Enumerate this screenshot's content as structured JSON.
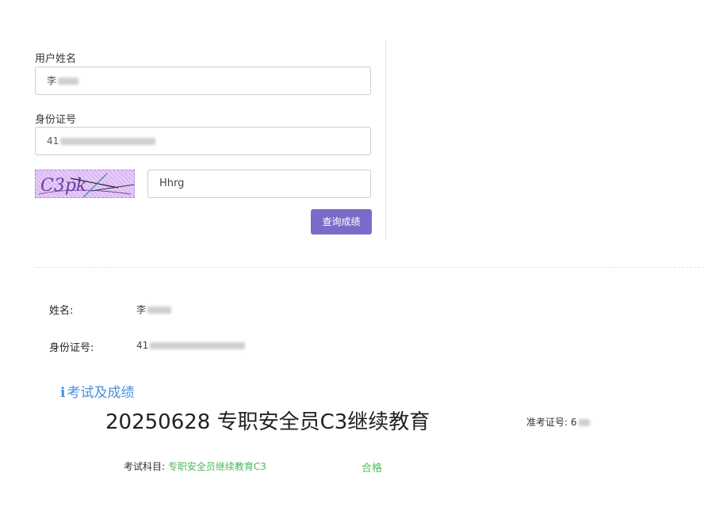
{
  "form": {
    "name_label": "用户姓名",
    "name_value": "李",
    "id_label": "身份证号",
    "id_value": "41",
    "captcha_text": "C3pk",
    "captcha_input": "Hhrg",
    "submit_label": "查询成绩"
  },
  "result": {
    "name_label": "姓名:",
    "name_value": "李",
    "id_label": "身份证号:",
    "id_value": "41",
    "section_title": "考试及成绩",
    "exam_name": "20250628 专职安全员C3继续教育",
    "ticket_label": "准考证号:",
    "ticket_value": "6",
    "subject_label": "考试科目:",
    "subject_value": "专职安全员继续教育C3",
    "outcome": "合格"
  },
  "colors": {
    "button": "#7b6bc9",
    "section_title": "#4a90d9",
    "success": "#4cb85c"
  }
}
